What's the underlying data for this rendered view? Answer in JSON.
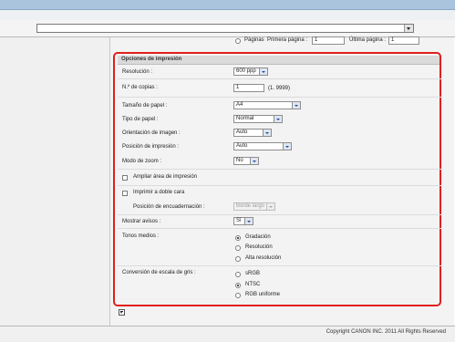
{
  "footer": {
    "copyright": "Copyright CANON INC. 2011 All Rights Reserved"
  },
  "pages_row": {
    "option_label": "Páginas",
    "first_label": "Primera página :",
    "first_value": "1",
    "last_label": "Última página :",
    "last_value": "1"
  },
  "print_options": {
    "header": "Opciones de impresión",
    "resolution": {
      "label": "Resolución :",
      "value": "600 ppp"
    },
    "copies": {
      "label": "N.º de copias :",
      "value": "1",
      "range": "(1. 9999)"
    },
    "paper_size": {
      "label": "Tamaño de papel :",
      "value": "A4"
    },
    "paper_type": {
      "label": "Tipo de papel :",
      "value": "Normal"
    },
    "image_orientation": {
      "label": "Orientación de imagen :",
      "value": "Auto"
    },
    "print_position": {
      "label": "Posición de impresión :",
      "value": "Auto"
    },
    "zoom_mode": {
      "label": "Modo de zoom :",
      "value": "No"
    },
    "expand_area": {
      "label": "Ampliar área de impresión",
      "checked": false
    },
    "duplex": {
      "label": "Imprimir a doble cara",
      "checked": false
    },
    "binding": {
      "label": "Posición de encuadernación :",
      "value": "Borde largo",
      "disabled": true
    },
    "show_warnings": {
      "label": "Mostrar avisos :",
      "value": "Sí"
    },
    "halftones": {
      "label": "Tonos medios :",
      "options": [
        "Gradación",
        "Resolución",
        "Alta resolución"
      ],
      "selected": "Gradación"
    },
    "grayscale": {
      "label": "Conversión de escala de gris :",
      "options": [
        "sRGB",
        "NTSC",
        "RGB uniforme"
      ],
      "selected": "NTSC"
    }
  },
  "colors": {
    "highlight_border": "#e0201e",
    "top_bar": "#a9c4dc",
    "select_arrow": "#1c4a9a"
  }
}
